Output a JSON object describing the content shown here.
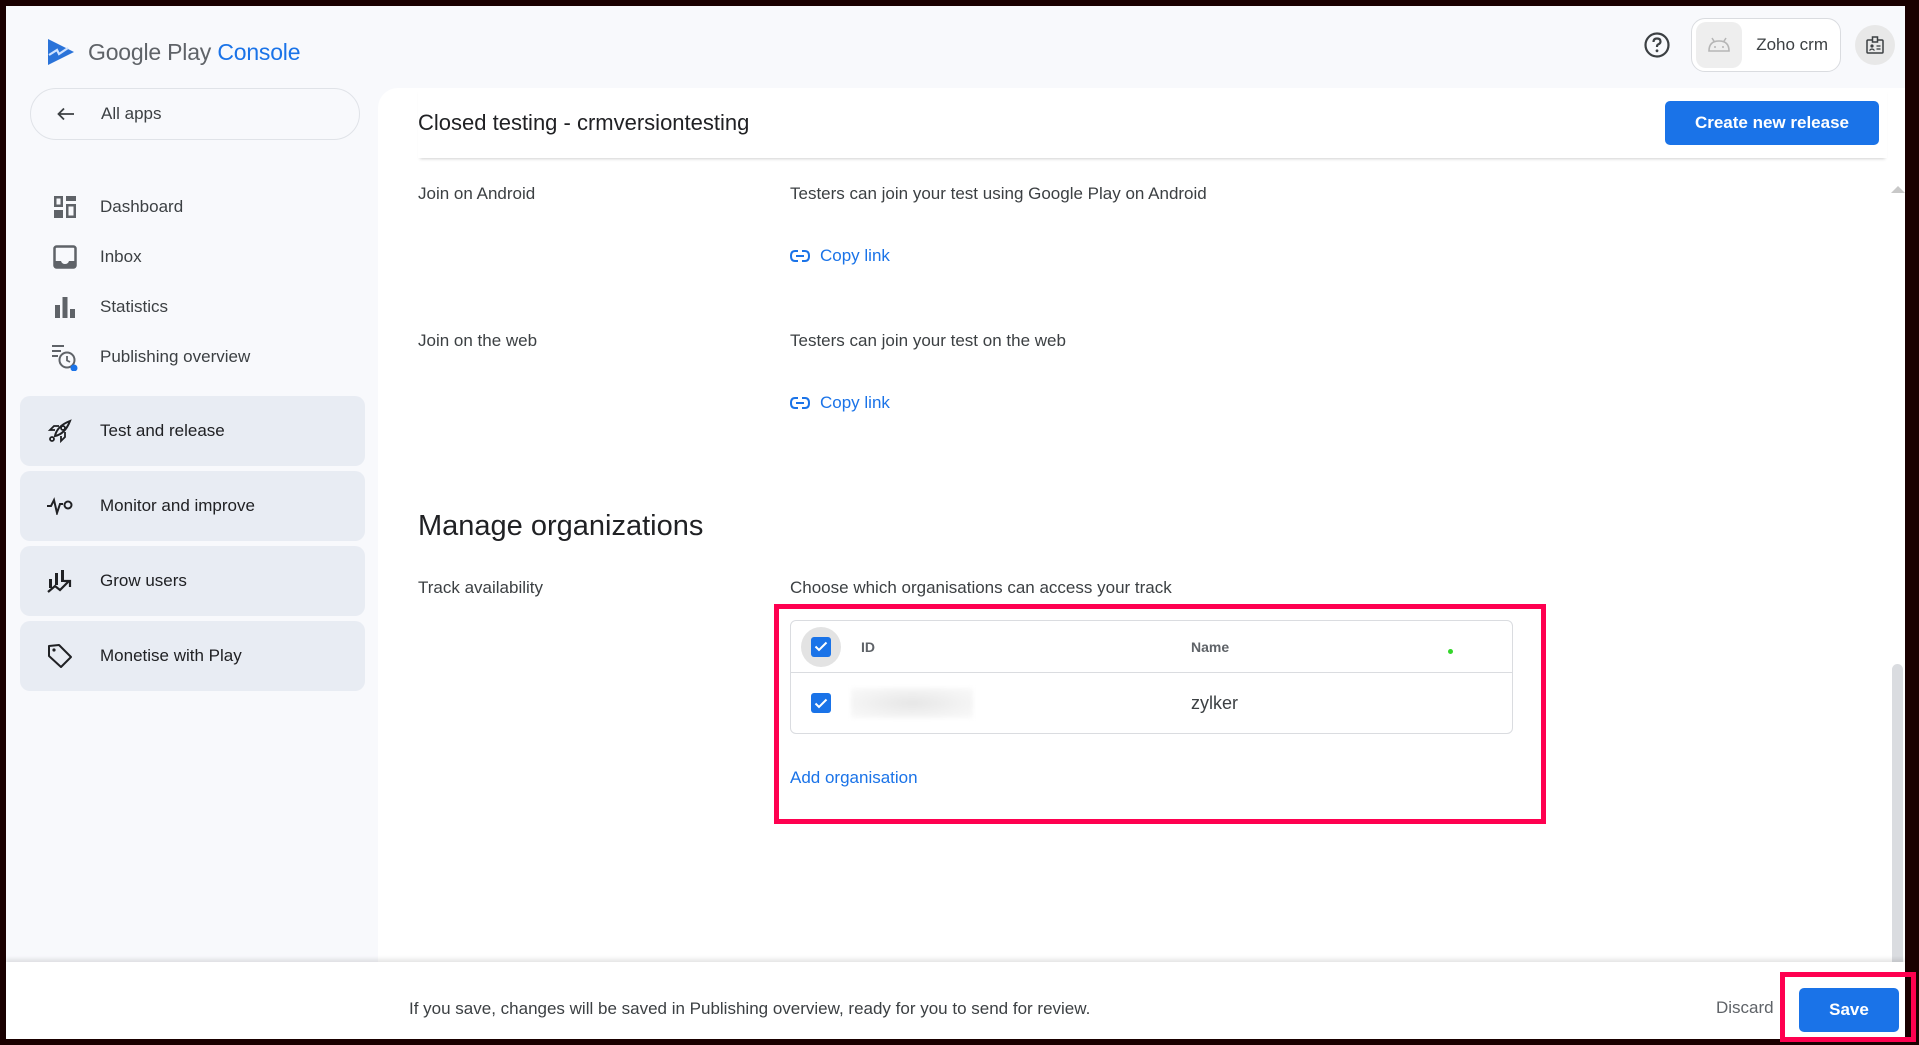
{
  "header": {
    "logo_text_primary": "Google Play",
    "logo_text_accent": "Console",
    "app_name": "Zoho crm"
  },
  "sidebar": {
    "all_apps_label": "All apps",
    "items": [
      {
        "label": "Dashboard",
        "icon": "dashboard-icon"
      },
      {
        "label": "Inbox",
        "icon": "inbox-icon"
      },
      {
        "label": "Statistics",
        "icon": "bar-chart-icon"
      },
      {
        "label": "Publishing overview",
        "icon": "publishing-overview-icon"
      }
    ],
    "groups": [
      {
        "label": "Test and release",
        "icon": "rocket-icon"
      },
      {
        "label": "Monitor and improve",
        "icon": "vitals-icon"
      },
      {
        "label": "Grow users",
        "icon": "grow-chart-icon"
      },
      {
        "label": "Monetise with Play",
        "icon": "tag-icon"
      }
    ]
  },
  "main": {
    "page_title": "Closed testing - crmversiontesting",
    "create_release_label": "Create new release",
    "join_android": {
      "label": "Join on Android",
      "description": "Testers can join your test using Google Play on Android",
      "link_label": "Copy link"
    },
    "join_web": {
      "label": "Join on the web",
      "description": "Testers can join your test on the web",
      "link_label": "Copy link"
    },
    "manage_orgs": {
      "title": "Manage organizations",
      "track_label": "Track availability",
      "track_description": "Choose which organisations can access your track",
      "columns": [
        "ID",
        "Name"
      ],
      "rows": [
        {
          "id": "",
          "name": "zylker",
          "checked": true
        }
      ],
      "select_all_checked": true,
      "add_label": "Add organisation"
    }
  },
  "footer": {
    "message": "If you save, changes will be saved in Publishing overview, ready for you to send for review.",
    "discard_label": "Discard",
    "save_label": "Save"
  },
  "colors": {
    "accent": "#1a73e8",
    "highlight": "#ff0050",
    "sidebar_group_bg": "#e8ecf3"
  }
}
